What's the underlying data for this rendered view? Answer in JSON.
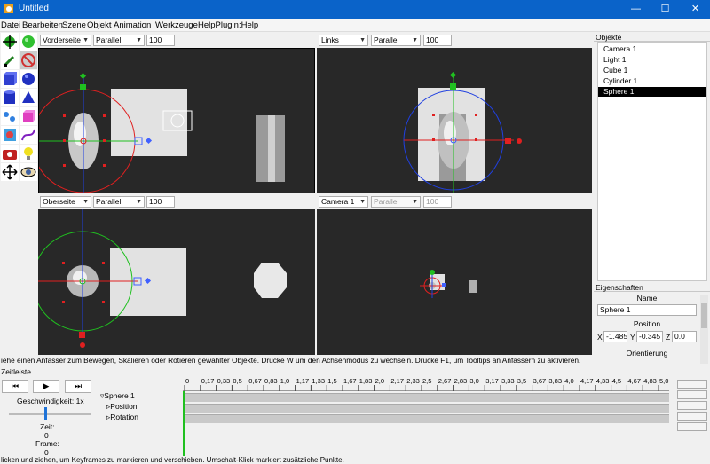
{
  "window": {
    "title": "Untitled",
    "minimize": "—",
    "maximize": "☐",
    "close": "✕"
  },
  "menu": [
    "Datei",
    "Bearbeiten",
    "Szene",
    "Objekt",
    "Animation",
    "Werkzeuge",
    "HelpPlugin:Help"
  ],
  "tools": [
    "move-tool-icon",
    "sphere-green-icon",
    "paint-tool-icon",
    "no-select-icon",
    "cube-primitive-icon",
    "sphere-primitive-icon",
    "cylinder-primitive-icon",
    "polygon-primitive-icon",
    "spline-tool-icon",
    "box-pink-icon",
    "texture-tool-icon",
    "curve-tool-icon",
    "camera-tool-icon",
    "light-bulb-icon",
    "pan-view-icon",
    "eye-view-icon"
  ],
  "viewports": [
    {
      "view": "Vorderseite",
      "mode": "Parallel",
      "scale": "100"
    },
    {
      "view": "Links",
      "mode": "Parallel",
      "scale": "100"
    },
    {
      "view": "Oberseite",
      "mode": "Parallel",
      "scale": "100"
    },
    {
      "view": "Camera 1",
      "mode": "Parallel",
      "scale": "100"
    }
  ],
  "status_hint": "iehe einen Anfasser zum Bewegen, Skalieren oder Rotieren gewählter Objekte. Drücke W um den Achsenmodus zu wechseln. Drücke F1, um Tooltips an Anfassern zu aktivieren.",
  "objects_panel": {
    "header": "Objekte",
    "items": [
      "Camera 1",
      "Light 1",
      "Cube 1",
      "Cylinder 1",
      "Sphere 1"
    ],
    "selected_index": 4
  },
  "properties_panel": {
    "header": "Eigenschaften",
    "name_label": "Name",
    "name_value": "Sphere 1",
    "position_label": "Position",
    "x_label": "X",
    "x_value": "-1.485",
    "y_label": "Y",
    "y_value": "-0.345",
    "z_label": "Z",
    "z_value": "0.0",
    "orientation_label": "Orientierung"
  },
  "timeline": {
    "header": "Zeitleiste",
    "speed_label": "Geschwindigkeit: 1x",
    "time_label": "Zeit:",
    "time_value": "0",
    "frame_label": "Frame:",
    "frame_value": "0",
    "tree": {
      "object": "Sphere 1",
      "tracks": [
        "Position",
        "Rotation"
      ]
    },
    "ruler_ticks": [
      "0",
      "0,17",
      "0,33",
      "0,5",
      "0,67",
      "0,83",
      "1,0",
      "1,17",
      "1,33",
      "1,5",
      "1,67",
      "1,83",
      "2,0",
      "2,17",
      "2,33",
      "2,5",
      "2,67",
      "2,83",
      "3,0",
      "3,17",
      "3,33",
      "3,5",
      "3,67",
      "3,83",
      "4,0",
      "4,17",
      "4,33",
      "4,5",
      "4,67",
      "4,83",
      "5,0"
    ],
    "buttons": {
      "rewind": "⏮",
      "play": "▶",
      "forward": "⏭"
    }
  },
  "bottom_status": "licken und ziehen, um Keyframes zu markieren und verschieben. Umschalt-Klick markiert zusätzliche Punkte.",
  "colors": {
    "titlebar": "#0a63c9",
    "viewport_bg": "#282828",
    "x_axis": "#e02020",
    "y_axis": "#20c020",
    "z_axis": "#2040e0"
  }
}
